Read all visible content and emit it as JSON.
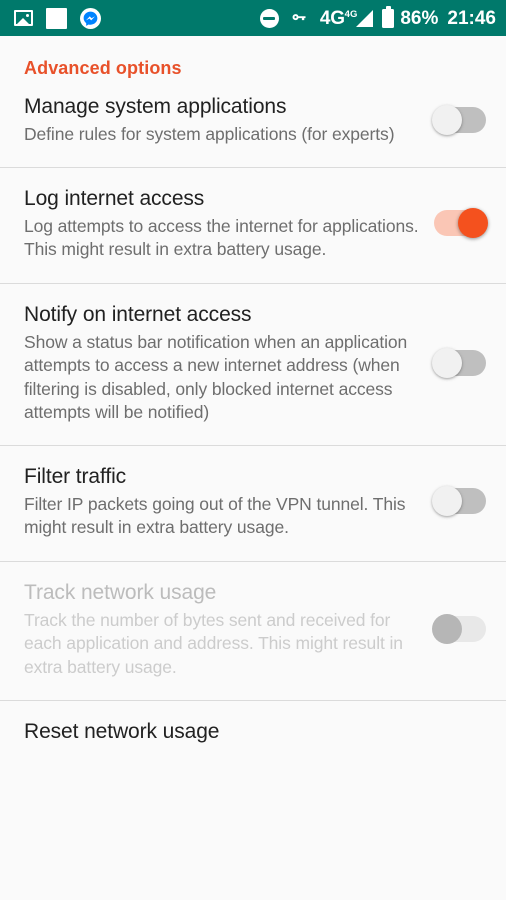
{
  "statusbar": {
    "background_color": "#00796B",
    "left_icons": [
      {
        "name": "photo-icon",
        "label": "Screenshot"
      },
      {
        "name": "white-square-icon",
        "label": "Notification"
      },
      {
        "name": "messenger-icon",
        "label": "Messenger"
      }
    ],
    "right_icons": [
      {
        "name": "do-not-disturb-icon",
        "label": "Do not disturb"
      },
      {
        "name": "vpn-key-icon",
        "label": "VPN"
      }
    ],
    "network_type": "4G",
    "network_superscript": "4G",
    "battery_percent": "86%",
    "clock": "21:46"
  },
  "page": {
    "section_header": "Advanced options",
    "accent_color": "#E8512A",
    "switch_on_color": "#F4511E",
    "background_color": "#FAFAFA"
  },
  "preferences": [
    {
      "id": "manage-system-applications",
      "title": "Manage system applications",
      "summary": "Define rules for system applications (for experts)",
      "switch_state": "off",
      "enabled": true
    },
    {
      "id": "log-internet-access",
      "title": "Log internet access",
      "summary": "Log attempts to access the internet for applications. This might result in extra battery usage.",
      "switch_state": "on",
      "enabled": true
    },
    {
      "id": "notify-on-internet-access",
      "title": "Notify on internet access",
      "summary": "Show a status bar notification when an application attempts to access a new internet address (when filtering is disabled, only blocked internet access attempts will be notified)",
      "switch_state": "off",
      "enabled": true
    },
    {
      "id": "filter-traffic",
      "title": "Filter traffic",
      "summary": "Filter IP packets going out of the VPN tunnel. This might result in extra battery usage.",
      "switch_state": "off",
      "enabled": true
    },
    {
      "id": "track-network-usage",
      "title": "Track network usage",
      "summary": "Track the number of bytes sent and received for each application and address. This might result in extra battery usage.",
      "switch_state": "off",
      "enabled": false
    },
    {
      "id": "reset-network-usage",
      "title": "Reset network usage",
      "summary": "",
      "switch_state": "none",
      "enabled": true
    }
  ]
}
